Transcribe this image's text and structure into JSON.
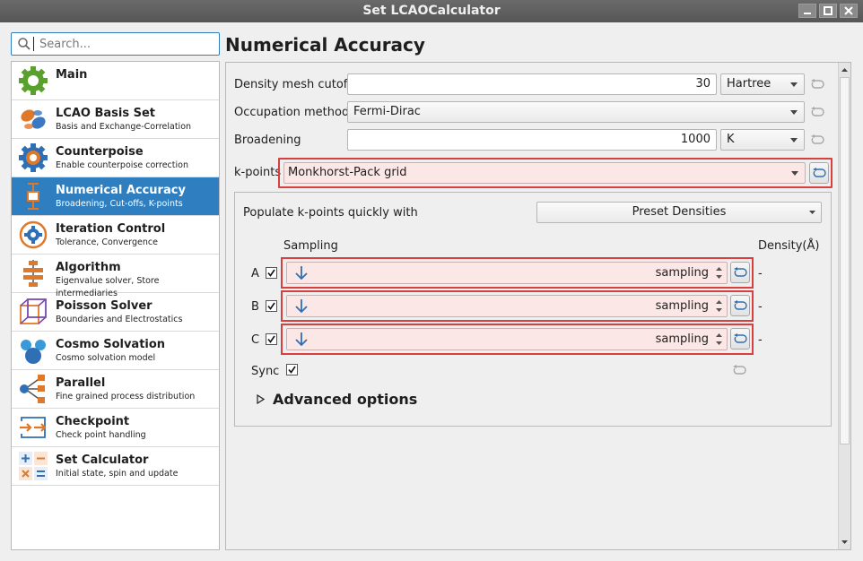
{
  "window": {
    "title": "Set LCAOCalculator"
  },
  "search": {
    "placeholder": "Search..."
  },
  "sidebar": {
    "items": [
      {
        "title": "Main",
        "subtitle": ""
      },
      {
        "title": "LCAO Basis Set",
        "subtitle": "Basis and Exchange-Correlation"
      },
      {
        "title": "Counterpoise",
        "subtitle": "Enable counterpoise correction"
      },
      {
        "title": "Numerical Accuracy",
        "subtitle": "Broadening, Cut-offs, K-points"
      },
      {
        "title": "Iteration Control",
        "subtitle": "Tolerance, Convergence"
      },
      {
        "title": "Algorithm",
        "subtitle": "Eigenvalue solver, Store intermediaries"
      },
      {
        "title": "Poisson Solver",
        "subtitle": "Boundaries and Electrostatics"
      },
      {
        "title": "Cosmo Solvation",
        "subtitle": "Cosmo solvation model"
      },
      {
        "title": "Parallel",
        "subtitle": "Fine grained process distribution"
      },
      {
        "title": "Checkpoint",
        "subtitle": "Check point handling"
      },
      {
        "title": "Set Calculator",
        "subtitle": "Initial state, spin  and update"
      }
    ],
    "active_index": 3
  },
  "page": {
    "title": "Numerical Accuracy"
  },
  "form": {
    "density_mesh": {
      "label": "Density mesh cutoff",
      "value": "30",
      "unit": "Hartree"
    },
    "occupation": {
      "label": "Occupation method",
      "value": "Fermi-Dirac"
    },
    "broadening": {
      "label": "Broadening",
      "value": "1000",
      "unit": "K"
    },
    "kpoints": {
      "label": "k-points",
      "value": "Monkhorst-Pack grid"
    }
  },
  "kgrid": {
    "populate_label": "Populate k-points quickly with",
    "preset_label": "Preset Densities",
    "sampling_header": "Sampling",
    "density_header": "Density(Å)",
    "rows": [
      {
        "axis": "A",
        "value": "sampling",
        "density": "-"
      },
      {
        "axis": "B",
        "value": "sampling",
        "density": "-"
      },
      {
        "axis": "C",
        "value": "sampling",
        "density": "-"
      }
    ],
    "sync_label": "Sync",
    "advanced_label": "Advanced options"
  },
  "colors": {
    "accent": "#2f7fc0",
    "highlight_border": "#d84040",
    "highlight_fill": "#fbe8e6"
  }
}
